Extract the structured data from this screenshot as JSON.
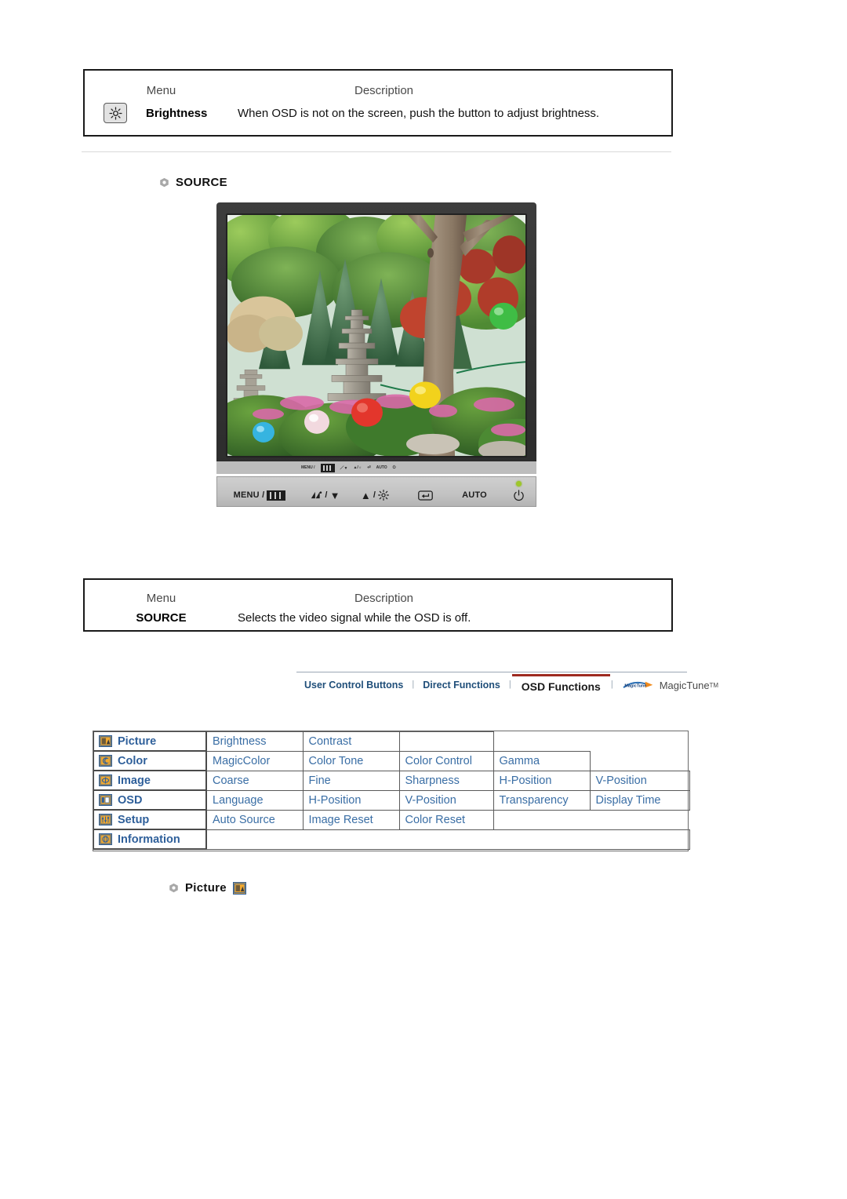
{
  "brightness_table": {
    "header_menu": "Menu",
    "header_description": "Description",
    "icon": "brightness-sun-icon",
    "menu_label": "Brightness",
    "description": "When OSD is not on the screen, push the button to adjust brightness."
  },
  "source_section": {
    "bullet_icon": "hex-bullet-icon",
    "heading": "SOURCE"
  },
  "monitor": {
    "alt": "LCD monitor displaying a garden photo with a stone pagoda and colorful lanterns",
    "mini_strip": [
      "MENU /",
      "/",
      "/",
      "",
      "AUTO",
      ""
    ],
    "buttons": [
      {
        "label": "MENU /",
        "icon": "menu-bars-icon"
      },
      {
        "label": "/",
        "icon": "magicbright-down-icon"
      },
      {
        "label": "/",
        "icon": "up-brightness-icon"
      },
      {
        "label": "",
        "icon": "enter-source-icon"
      },
      {
        "label": "AUTO",
        "icon": "auto-icon"
      },
      {
        "label": "",
        "icon": "power-icon"
      }
    ],
    "power_led": "power-led-green"
  },
  "source_table": {
    "header_menu": "Menu",
    "header_description": "Description",
    "menu_label": "SOURCE",
    "description": "Selects the video signal while the OSD is off."
  },
  "tabs": {
    "items": [
      {
        "label": "User Control Buttons",
        "active": false
      },
      {
        "label": "Direct Functions",
        "active": false
      },
      {
        "label": "OSD Functions",
        "active": true
      },
      {
        "label": "MagicTune",
        "active": false,
        "icon": "magictune-logo-icon",
        "tm": "TM"
      }
    ],
    "separator": "|"
  },
  "osd_functions": {
    "rows": [
      {
        "icon": "picture-icon",
        "category": "Picture",
        "items": [
          "Brightness",
          "Contrast"
        ]
      },
      {
        "icon": "color-icon",
        "category": "Color",
        "items": [
          "MagicColor",
          "Color Tone",
          "Color Control",
          "Gamma"
        ]
      },
      {
        "icon": "image-icon",
        "category": "Image",
        "items": [
          "Coarse",
          "Fine",
          "Sharpness",
          "H-Position",
          "V-Position"
        ]
      },
      {
        "icon": "osd-icon",
        "category": "OSD",
        "items": [
          "Language",
          "H-Position",
          "V-Position",
          "Transparency",
          "Display Time"
        ]
      },
      {
        "icon": "setup-icon",
        "category": "Setup",
        "items": [
          "Auto Source",
          "Image Reset",
          "Color Reset"
        ]
      },
      {
        "icon": "information-icon",
        "category": "Information",
        "items": []
      }
    ]
  },
  "picture_section": {
    "bullet_icon": "hex-bullet-icon",
    "heading": "Picture",
    "icon": "picture-icon"
  },
  "colors": {
    "link_blue": "#3a6ea5",
    "category_blue": "#2e5f9a",
    "icon_orange": "#f0a830",
    "active_tab_underline": "#9e2a20",
    "tab_blue": "#1f4e79",
    "led_green": "#9ec72a"
  }
}
